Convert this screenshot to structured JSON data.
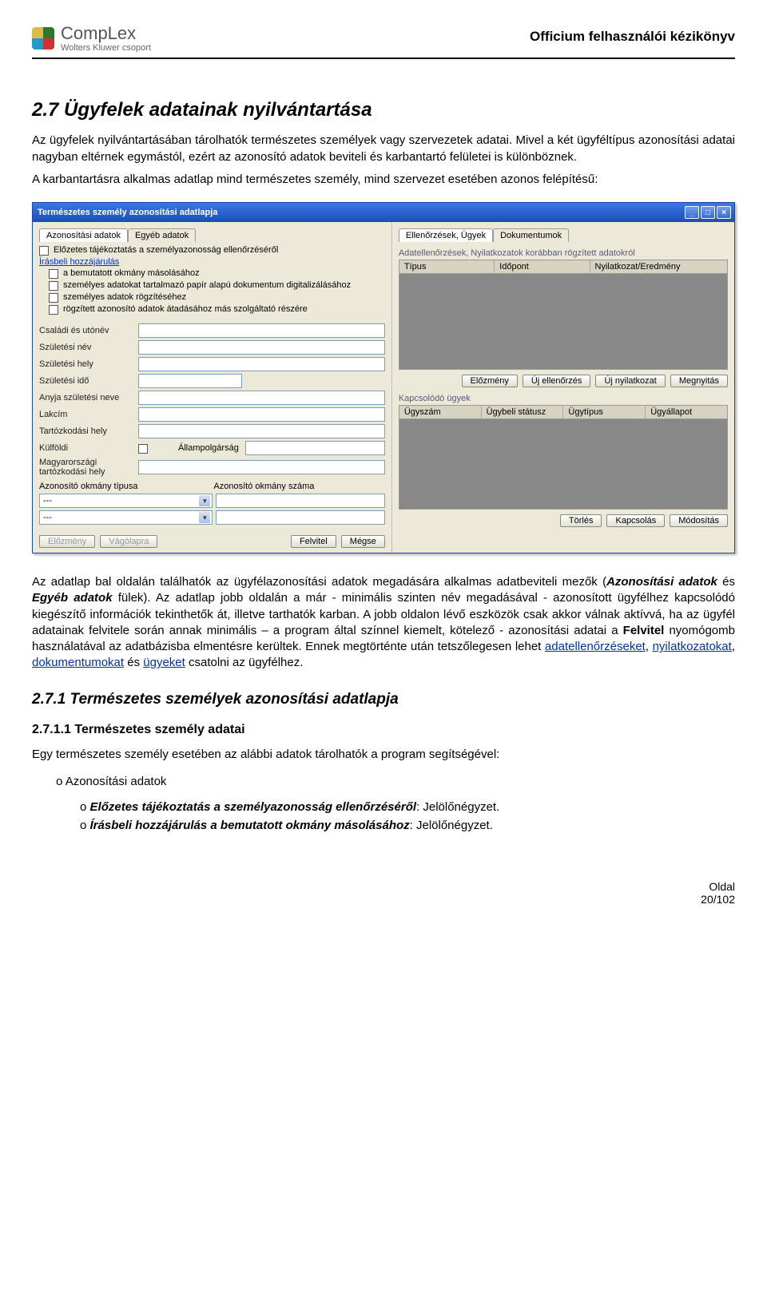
{
  "header": {
    "logo_main": "CompLex",
    "logo_sub": "Wolters Kluwer csoport",
    "title": "Officium felhasználói kézikönyv"
  },
  "sec27": {
    "title": "2.7  Ügyfelek adatainak nyilvántartása",
    "p1": "Az ügyfelek nyilvántartásában tárolhatók természetes személyek vagy szervezetek adatai. Mivel a két ügyféltípus azonosítási adatai nagyban eltérnek egymástól, ezért az azonosító adatok beviteli és karbantartó felületei is különböznek.",
    "p2": "A karbantartásra alkalmas adatlap mind természetes személy, mind szervezet esetében azonos felépítésű:"
  },
  "win": {
    "title": "Természetes személy azonosítási adatlapja",
    "left": {
      "tab1": "Azonosítási adatok",
      "tab2": "Egyéb adatok",
      "chk_header": "Előzetes tájékoztatás a személyazonosság ellenőrzéséről",
      "consent_link": "Írásbeli hozzájárulás",
      "chk1": "a bemutatott okmány másolásához",
      "chk2": "személyes adatokat tartalmazó papír alapú dokumentum digitalizálásához",
      "chk3": "személyes adatok rögzítéséhez",
      "chk4": "rögzített azonosító adatok átadásához más szolgáltató részére",
      "labels": {
        "csaladi": "Családi és utónév",
        "szulnev": "Születési név",
        "szulhely": "Születési hely",
        "szulido": "Születési idő",
        "anyja": "Anyja születési neve",
        "lakcim": "Lakcím",
        "tart": "Tartózkodási hely",
        "kulfoldi": "Külföldi",
        "allampolg": "Állampolgárság",
        "magytart": "Magyarországi tartózkodási hely",
        "okmanytipus": "Azonosító okmány típusa",
        "okmanyszama": "Azonosító okmány száma",
        "dd_placeholder": "---"
      },
      "footer": {
        "elozmeny": "Előzmény",
        "vagolapra": "Vágólapra",
        "felvitel": "Felvitel",
        "megse": "Mégse"
      }
    },
    "right": {
      "tab1": "Ellenőrzések, Ügyek",
      "tab2": "Dokumentumok",
      "grp1": "Adatellenőrzések, Nyilatkozatok korábban rögzített adatokról",
      "cols1": {
        "c1": "Típus",
        "c2": "Időpont",
        "c3": "Nyilatkozat/Eredmény"
      },
      "btns1": {
        "b1": "Előzmény",
        "b2": "Új ellenőrzés",
        "b3": "Új nyilatkozat",
        "b4": "Megnyitás"
      },
      "grp2": "Kapcsolódó ügyek",
      "cols2": {
        "c1": "Ügyszám",
        "c2": "Ügybeli státusz",
        "c3": "Ügytípus",
        "c4": "Ügyállapot"
      },
      "btns2": {
        "b1": "Törlés",
        "b2": "Kapcsolás",
        "b3": "Módosítás"
      }
    }
  },
  "after": {
    "p1a": "Az adatlap bal oldalán találhatók az ügyfélazonosítási adatok megadására alkalmas adatbeviteli mezők (",
    "p1b": "Azonosítási adatok",
    "p1c": " és ",
    "p1d": "Egyéb adatok",
    "p1e": " fülek). Az adatlap jobb oldalán a már - minimális szinten név megadásával - azonosított ügyfélhez kapcsolódó kiegészítő információk tekinthetők át, illetve tarthatók karban. A jobb oldalon lévő eszközök csak akkor válnak aktívvá, ha az ügyfél adatainak felvitele során annak minimális – a program által színnel kiemelt, kötelező - azonosítási adatai a ",
    "p1f": "Felvitel",
    "p1g": " nyomógomb használatával az adatbázisba elmentésre kerültek. Ennek megtörténte után tetszőlegesen lehet ",
    "link1": "adatellenőrzéseket",
    "sep1": ", ",
    "link2": "nyilatkozatokat",
    "sep2": ", ",
    "link3": "dokumentumokat",
    "sep3": " és ",
    "link4": "ügyeket",
    "p1h": " csatolni az ügyfélhez."
  },
  "sec271": {
    "title": "2.7.1  Természetes személyek azonosítási adatlapja",
    "sub2711": "2.7.1.1   Természetes személy adatai",
    "p1": "Egy természetes személy esetében az alábbi adatok tárolhatók a program segítségével:",
    "b1": "Azonosítási adatok",
    "b2a": "Előzetes tájékoztatás a személyazonosság ellenőrzéséről",
    "b2b": ": Jelölőnégyzet.",
    "b3a": "Írásbeli hozzájárulás a bemutatott okmány másolásához",
    "b3b": ": Jelölőnégyzet."
  },
  "footer": {
    "l1": "Oldal",
    "l2": "20/102"
  }
}
